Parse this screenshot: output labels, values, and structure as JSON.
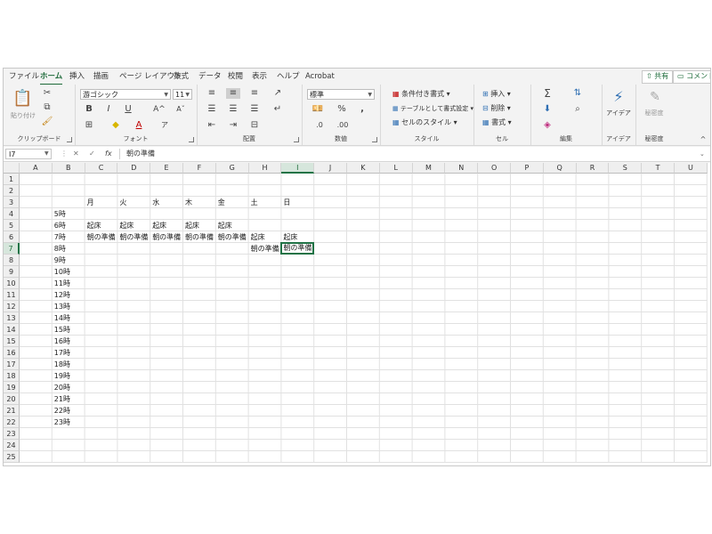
{
  "tabs": [
    {
      "label": "ファイル",
      "active": false
    },
    {
      "label": "ホーム",
      "active": true
    },
    {
      "label": "挿入",
      "active": false
    },
    {
      "label": "描画",
      "active": false
    },
    {
      "label": "ページ レイアウト",
      "active": false
    },
    {
      "label": "数式",
      "active": false
    },
    {
      "label": "データ",
      "active": false
    },
    {
      "label": "校閲",
      "active": false
    },
    {
      "label": "表示",
      "active": false
    },
    {
      "label": "ヘルプ",
      "active": false
    },
    {
      "label": "Acrobat",
      "active": false
    }
  ],
  "topbar": {
    "share_label": "共有",
    "comment_label": "コメント"
  },
  "ribbon": {
    "clipboard": {
      "label": "クリップボード",
      "paste_label": "貼り付け"
    },
    "font": {
      "label": "フォント",
      "font_name": "游ゴシック",
      "font_size": "11",
      "bold": "B",
      "italic": "I",
      "underline": "U"
    },
    "alignment": {
      "label": "配置"
    },
    "number": {
      "label": "数値",
      "format": "標準",
      "percent": "%"
    },
    "styles": {
      "label": "スタイル",
      "conditional": "条件付き書式",
      "as_table": "テーブルとして書式設定",
      "cell_styles": "セルのスタイル"
    },
    "cells": {
      "label": "セル",
      "insert": "挿入",
      "delete": "削除",
      "format": "書式"
    },
    "editing": {
      "label": "編集"
    },
    "ideas": {
      "label": "アイデア",
      "button": "アイデア"
    },
    "sensitivity": {
      "label": "秘密度",
      "button": "秘密度"
    }
  },
  "formula_bar": {
    "name_box": "I7",
    "content": "朝の準備",
    "fx": "fx"
  },
  "columns": [
    "A",
    "B",
    "C",
    "D",
    "E",
    "F",
    "G",
    "H",
    "I",
    "J",
    "K",
    "L",
    "M",
    "N",
    "O",
    "P",
    "Q",
    "R",
    "S",
    "T",
    "U"
  ],
  "selected_column": "I",
  "rows": [
    "1",
    "2",
    "3",
    "4",
    "5",
    "6",
    "7",
    "8",
    "9",
    "10",
    "11",
    "12",
    "13",
    "14",
    "15",
    "16",
    "17",
    "18",
    "19",
    "20",
    "21",
    "22",
    "23",
    "24",
    "25"
  ],
  "selected_row": "7",
  "cells": [
    {
      "col": "C",
      "row": "3",
      "v": "月"
    },
    {
      "col": "D",
      "row": "3",
      "v": "火"
    },
    {
      "col": "E",
      "row": "3",
      "v": "水"
    },
    {
      "col": "F",
      "row": "3",
      "v": "木"
    },
    {
      "col": "G",
      "row": "3",
      "v": "金"
    },
    {
      "col": "H",
      "row": "3",
      "v": "土"
    },
    {
      "col": "I",
      "row": "3",
      "v": "日"
    },
    {
      "col": "B",
      "row": "4",
      "v": "5時"
    },
    {
      "col": "B",
      "row": "5",
      "v": "6時"
    },
    {
      "col": "C",
      "row": "5",
      "v": "起床"
    },
    {
      "col": "D",
      "row": "5",
      "v": "起床"
    },
    {
      "col": "E",
      "row": "5",
      "v": "起床"
    },
    {
      "col": "F",
      "row": "5",
      "v": "起床"
    },
    {
      "col": "G",
      "row": "5",
      "v": "起床"
    },
    {
      "col": "B",
      "row": "6",
      "v": "7時"
    },
    {
      "col": "C",
      "row": "6",
      "v": "朝の準備"
    },
    {
      "col": "D",
      "row": "6",
      "v": "朝の準備"
    },
    {
      "col": "E",
      "row": "6",
      "v": "朝の準備"
    },
    {
      "col": "F",
      "row": "6",
      "v": "朝の準備"
    },
    {
      "col": "G",
      "row": "6",
      "v": "朝の準備"
    },
    {
      "col": "H",
      "row": "6",
      "v": "起床"
    },
    {
      "col": "I",
      "row": "6",
      "v": "起床"
    },
    {
      "col": "B",
      "row": "7",
      "v": "8時"
    },
    {
      "col": "H",
      "row": "7",
      "v": "朝の準備"
    },
    {
      "col": "I",
      "row": "7",
      "v": "朝の準備",
      "active": true
    },
    {
      "col": "B",
      "row": "8",
      "v": "9時"
    },
    {
      "col": "B",
      "row": "9",
      "v": "10時"
    },
    {
      "col": "B",
      "row": "10",
      "v": "11時"
    },
    {
      "col": "B",
      "row": "11",
      "v": "12時"
    },
    {
      "col": "B",
      "row": "12",
      "v": "13時"
    },
    {
      "col": "B",
      "row": "13",
      "v": "14時"
    },
    {
      "col": "B",
      "row": "14",
      "v": "15時"
    },
    {
      "col": "B",
      "row": "15",
      "v": "16時"
    },
    {
      "col": "B",
      "row": "16",
      "v": "17時"
    },
    {
      "col": "B",
      "row": "17",
      "v": "18時"
    },
    {
      "col": "B",
      "row": "18",
      "v": "19時"
    },
    {
      "col": "B",
      "row": "19",
      "v": "20時"
    },
    {
      "col": "B",
      "row": "20",
      "v": "21時"
    },
    {
      "col": "B",
      "row": "21",
      "v": "22時"
    },
    {
      "col": "B",
      "row": "22",
      "v": "23時"
    }
  ]
}
